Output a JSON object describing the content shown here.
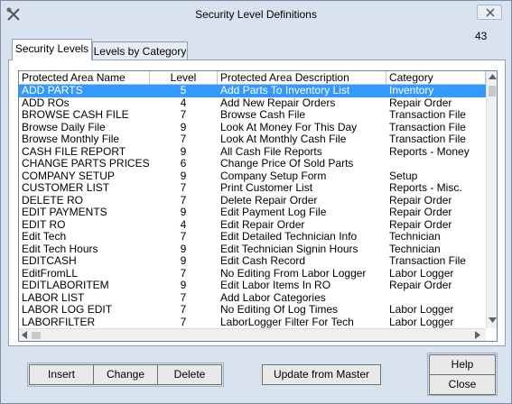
{
  "window": {
    "title": "Security Level Definitions",
    "counter": "43"
  },
  "tabs": [
    {
      "label": "Security Levels",
      "active": true
    },
    {
      "label": "Levels by Category",
      "active": false
    }
  ],
  "grid": {
    "columns": [
      "Protected Area Name",
      "Level",
      "Protected Area Description",
      "Category"
    ],
    "selected_row": 0,
    "rows": [
      [
        "ADD PARTS",
        "5",
        "Add Parts To Inventory List",
        "Inventory"
      ],
      [
        "ADD ROs",
        "4",
        "Add New Repair Orders",
        "Repair Order"
      ],
      [
        "BROWSE CASH FILE",
        "7",
        "Browse Cash File",
        "Transaction File"
      ],
      [
        "Browse Daily File",
        "9",
        "Look At Money For This Day",
        "Transaction File"
      ],
      [
        "Browse Monthly File",
        "7",
        "Look At Monthly Cash File",
        "Transaction File"
      ],
      [
        "CASH FILE REPORT",
        "9",
        "All Cash File Reports",
        "Reports - Money"
      ],
      [
        "CHANGE PARTS PRICES",
        "6",
        "Change Price Of Sold Parts",
        ""
      ],
      [
        "COMPANY SETUP",
        "9",
        "Company Setup Form",
        "Setup"
      ],
      [
        "CUSTOMER LIST",
        "7",
        "Print Customer List",
        "Reports - Misc."
      ],
      [
        "DELETE RO",
        "7",
        "Delete Repair Order",
        "Repair Order"
      ],
      [
        "EDIT PAYMENTS",
        "9",
        "Edit Payment Log File",
        "Repair Order"
      ],
      [
        "EDIT RO",
        "4",
        "Edit Repair Order",
        "Repair Order"
      ],
      [
        "Edit Tech",
        "7",
        "Edit Detailed Technician Info",
        "Technician"
      ],
      [
        "Edit Tech Hours",
        "9",
        "Edit Technician Signin Hours",
        "Technician"
      ],
      [
        "EDITCASH",
        "9",
        "Edit Cash Record",
        "Transaction File"
      ],
      [
        "EditFromLL",
        "7",
        "No Editing From Labor Logger",
        "Labor Logger"
      ],
      [
        "EDITLABORITEM",
        "9",
        "Edit Labor Items In RO",
        "Repair Order"
      ],
      [
        "LABOR LIST",
        "7",
        "Add Labor Categories",
        ""
      ],
      [
        "LABOR LOG EDIT",
        "7",
        "No Editing Of Log Times",
        "Labor Logger"
      ],
      [
        "LABORFILTER",
        "7",
        "LaborLogger Filter For Tech",
        "Labor Logger"
      ]
    ]
  },
  "buttons": {
    "insert": "Insert",
    "change": "Change",
    "delete": "Delete",
    "update": "Update from Master",
    "help": "Help",
    "close": "Close"
  },
  "icons": {
    "app": "tools-icon",
    "close": "close-icon"
  },
  "colors": {
    "selection": "#3399ff",
    "window_bg": "#d9e3ef"
  }
}
